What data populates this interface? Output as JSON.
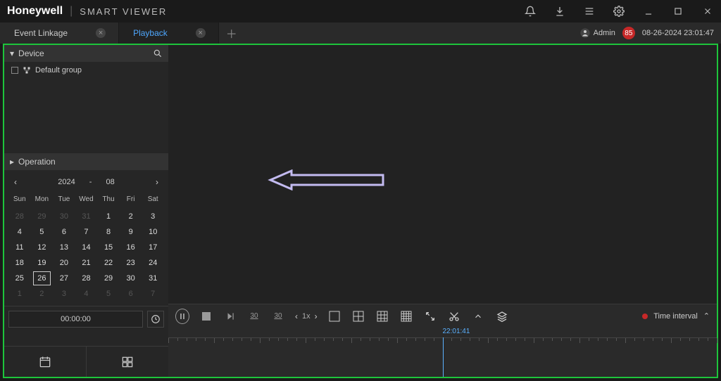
{
  "brand": "Honeywell",
  "app_name": "SMART VIEWER",
  "tabs": [
    {
      "label": "Event Linkage",
      "active": false
    },
    {
      "label": "Playback",
      "active": true
    }
  ],
  "user": {
    "name": "Admin",
    "notification_count": "85",
    "datetime": "08-26-2024 23:01:47"
  },
  "sidebar": {
    "device_title": "Device",
    "tree_item": "Default group",
    "operation_title": "Operation",
    "calendar": {
      "year": "2024",
      "month": "08",
      "dow": [
        "Sun",
        "Mon",
        "Tue",
        "Wed",
        "Thu",
        "Fri",
        "Sat"
      ],
      "weeks": [
        [
          {
            "n": "28",
            "dim": true
          },
          {
            "n": "29",
            "dim": true
          },
          {
            "n": "30",
            "dim": true
          },
          {
            "n": "31",
            "dim": true
          },
          {
            "n": "1"
          },
          {
            "n": "2"
          },
          {
            "n": "3"
          }
        ],
        [
          {
            "n": "4"
          },
          {
            "n": "5"
          },
          {
            "n": "6"
          },
          {
            "n": "7"
          },
          {
            "n": "8"
          },
          {
            "n": "9"
          },
          {
            "n": "10"
          }
        ],
        [
          {
            "n": "11"
          },
          {
            "n": "12"
          },
          {
            "n": "13"
          },
          {
            "n": "14"
          },
          {
            "n": "15"
          },
          {
            "n": "16"
          },
          {
            "n": "17"
          }
        ],
        [
          {
            "n": "18"
          },
          {
            "n": "19"
          },
          {
            "n": "20"
          },
          {
            "n": "21"
          },
          {
            "n": "22"
          },
          {
            "n": "23"
          },
          {
            "n": "24"
          }
        ],
        [
          {
            "n": "25"
          },
          {
            "n": "26",
            "sel": true
          },
          {
            "n": "27"
          },
          {
            "n": "28"
          },
          {
            "n": "29"
          },
          {
            "n": "30"
          },
          {
            "n": "31"
          }
        ],
        [
          {
            "n": "1",
            "dim": true
          },
          {
            "n": "2",
            "dim": true
          },
          {
            "n": "3",
            "dim": true
          },
          {
            "n": "4",
            "dim": true
          },
          {
            "n": "5",
            "dim": true
          },
          {
            "n": "6",
            "dim": true
          },
          {
            "n": "7",
            "dim": true
          }
        ]
      ]
    },
    "time_value": "00:00:00"
  },
  "controls": {
    "speed": "1x",
    "skip_back": "30",
    "skip_fwd": "30",
    "time_interval_label": "Time interval",
    "playhead_time": "22:01:41"
  }
}
